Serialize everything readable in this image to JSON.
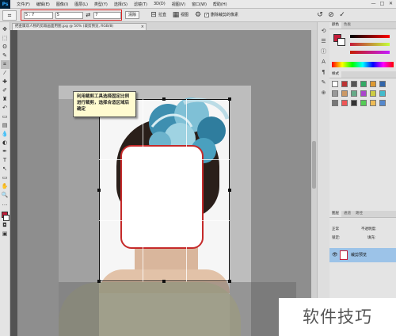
{
  "app": {
    "logo": "Ps"
  },
  "menu": [
    "文件(F)",
    "编辑(E)",
    "图像(I)",
    "图层(L)",
    "类型(Y)",
    "选择(S)",
    "滤镜(T)",
    "3D(D)",
    "视图(V)",
    "窗口(W)",
    "帮助(H)"
  ],
  "window_controls": [
    "—",
    "□",
    "✕"
  ],
  "options": {
    "ratio_select": "5 : 7",
    "width_value": "5",
    "height_value": "7",
    "straighten_label": "拉直",
    "view_label": "视图",
    "delete_pixels_label": "删除裁剪的像素",
    "reset_icon": "↺",
    "cancel_icon": "⊘",
    "commit_icon": "✓"
  },
  "document": {
    "tab_label": "把金属双人物的剪裁画面用图.jpg @ 50% (裁剪预览, RGB/8)",
    "close": "×"
  },
  "callout": {
    "text": "利用裁剪工具选择固定比例进行裁剪，选择合适区域后确定"
  },
  "panels": {
    "color_tabs": [
      "颜色",
      "色板"
    ],
    "styles_tab": "样式",
    "layers_tabs": [
      "图层",
      "通道",
      "路径"
    ],
    "blend_mode": "正常",
    "opacity_label": "不透明度:",
    "lock_label": "锁定:",
    "fill_label": "填充:",
    "layer_name": "裁剪预览"
  },
  "colors": {
    "foreground": "#c41e3a",
    "accent_red": "#d22222",
    "selected_layer": "#9cc3e8"
  },
  "watermark": "软件技巧"
}
